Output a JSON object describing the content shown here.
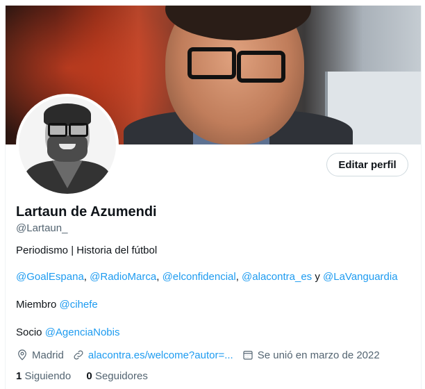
{
  "profile": {
    "name": "Lartaun de Azumendi",
    "handle": "@Lartaun_",
    "edit_label": "Editar perfil",
    "bio": "Periodismo | Historia del fútbol",
    "mentions": {
      "m1": "@GoalEspana",
      "sep1": ", ",
      "m2": "@RadioMarca",
      "sep2": ", ",
      "m3": "@elconfidencial",
      "sep3": ", ",
      "m4": "@alacontra_es",
      "sep4": " y ",
      "m5": "@LaVanguardia"
    },
    "member": {
      "label": "Miembro ",
      "mention": "@cihefe"
    },
    "partner": {
      "label": "Socio ",
      "mention": "@AgenciaNobis"
    },
    "location": "Madrid",
    "website": "alacontra.es/welcome?autor=...",
    "joined": "Se unió en marzo de 2022",
    "following_count": "1",
    "following_label": "Siguiendo",
    "followers_count": "0",
    "followers_label": "Seguidores",
    "icons": {
      "location": "location-pin-icon",
      "link": "link-icon",
      "calendar": "calendar-icon"
    },
    "colors": {
      "accent": "#1d9bf0",
      "text": "#0f1419",
      "secondary": "#536471"
    }
  }
}
